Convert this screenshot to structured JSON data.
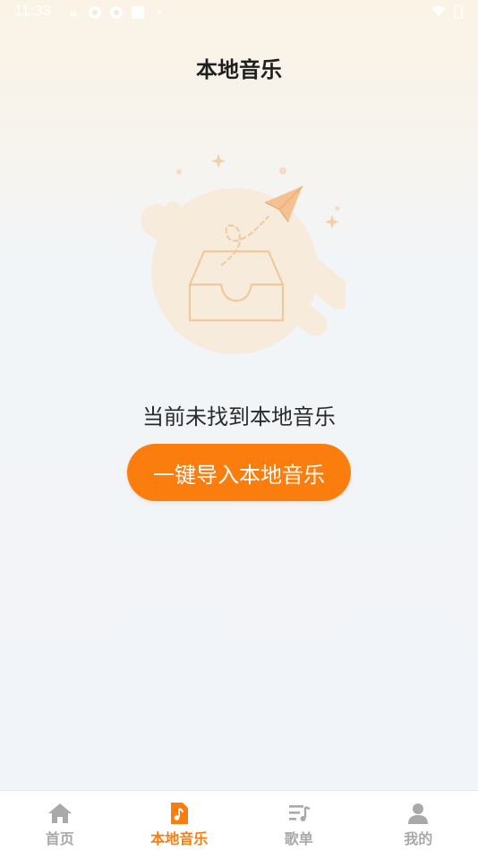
{
  "status_bar": {
    "time": "11:33"
  },
  "header": {
    "title": "本地音乐"
  },
  "empty_state": {
    "message": "当前未找到本地音乐",
    "illustration_icon": "empty-inbox-paper-plane-icon"
  },
  "actions": {
    "import_label": "一键导入本地音乐"
  },
  "bottom_nav": {
    "items": [
      {
        "label": "首页",
        "icon": "home-icon",
        "active": false
      },
      {
        "label": "本地音乐",
        "icon": "music-file-icon",
        "active": true
      },
      {
        "label": "歌单",
        "icon": "playlist-icon",
        "active": false
      },
      {
        "label": "我的",
        "icon": "user-icon",
        "active": false
      }
    ]
  },
  "colors": {
    "accent": "#fb7d0d",
    "inactive": "#a9a9a9",
    "illustration": "#f2c79a"
  }
}
